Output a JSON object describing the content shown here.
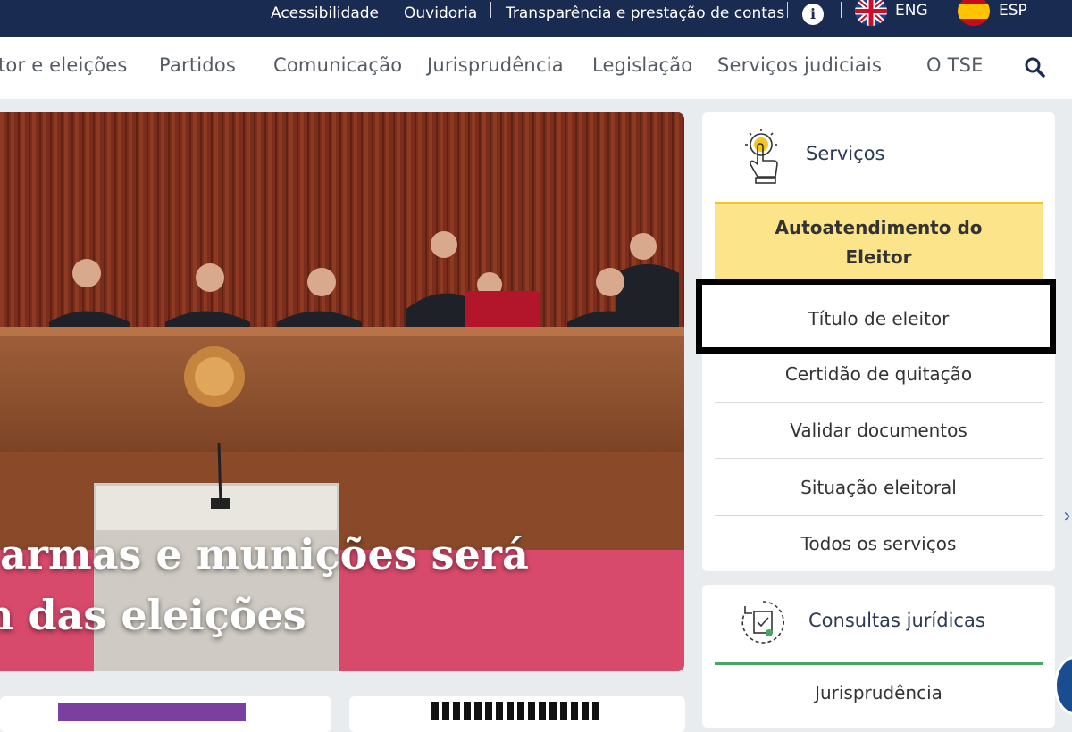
{
  "topbar": {
    "links": [
      "Acessibilidade",
      "Ouvidoria",
      "Transparência e prestação de contas"
    ],
    "lang_eng": "ENG",
    "lang_esp": "ESP",
    "info_icon": "info-icon"
  },
  "nav": {
    "items": [
      "tor e eleições",
      "Partidos",
      "Comunicação",
      "Jurisprudência",
      "Legislação",
      "Serviços judiciais",
      "O TSE"
    ],
    "search_icon": "search-icon"
  },
  "hero": {
    "headline_line1": "armas e munições será",
    "headline_line2": "n das eleições"
  },
  "services": {
    "title": "Serviços",
    "icon": "touch-hand-icon",
    "highlight_line1": "Autoatendimento do",
    "highlight_line2": "Eleitor",
    "items": [
      "Título de eleitor",
      "Certidão de quitação",
      "Validar documentos",
      "Situação eleitoral",
      "Todos os serviços"
    ]
  },
  "consultas": {
    "title": "Consultas jurídicas",
    "icon": "document-refresh-icon",
    "items": [
      "Jurisprudência"
    ]
  },
  "colors": {
    "topbar_bg": "#1a2b52",
    "highlight_bg": "#fce48b",
    "highlight_border": "#f3c623",
    "accent_green": "#4aa562"
  }
}
